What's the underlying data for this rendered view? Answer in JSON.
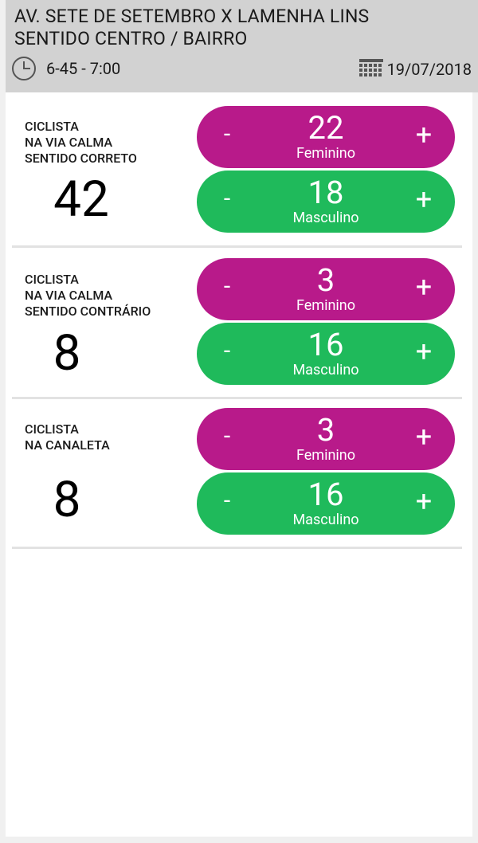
{
  "header": {
    "title_line1": "AV. SETE DE SETEMBRO X LAMENHA LINS",
    "title_line2": "SENTIDO CENTRO / BAIRRO",
    "time_range": "6-45 - 7:00",
    "date": "19/07/2018",
    "time_icon": "clock-icon",
    "date_icon": "calendar-icon"
  },
  "colors": {
    "feminino": "#b81a8a",
    "masculino": "#1fba5b",
    "header_bg": "#d2d2d2"
  },
  "sections": [
    {
      "label_lines": [
        "CICLISTA",
        "NA VIA CALMA",
        "SENTIDO CORRETO"
      ],
      "total": "42",
      "female": {
        "count": "22",
        "label": "Feminino",
        "minus": "-",
        "plus": "+"
      },
      "male": {
        "count": "18",
        "label": "Masculino",
        "minus": "-",
        "plus": "+"
      }
    },
    {
      "label_lines": [
        "CICLISTA",
        "NA VIA CALMA",
        "SENTIDO CONTRÁRIO"
      ],
      "total": "8",
      "female": {
        "count": "3",
        "label": "Feminino",
        "minus": "-",
        "plus": "+"
      },
      "male": {
        "count": "16",
        "label": "Masculino",
        "minus": "-",
        "plus": "+"
      }
    },
    {
      "label_lines": [
        "CICLISTA",
        "NA CANALETA"
      ],
      "total": "8",
      "female": {
        "count": "3",
        "label": "Feminino",
        "minus": "-",
        "plus": "+"
      },
      "male": {
        "count": "16",
        "label": "Masculino",
        "minus": "-",
        "plus": "+"
      }
    }
  ]
}
